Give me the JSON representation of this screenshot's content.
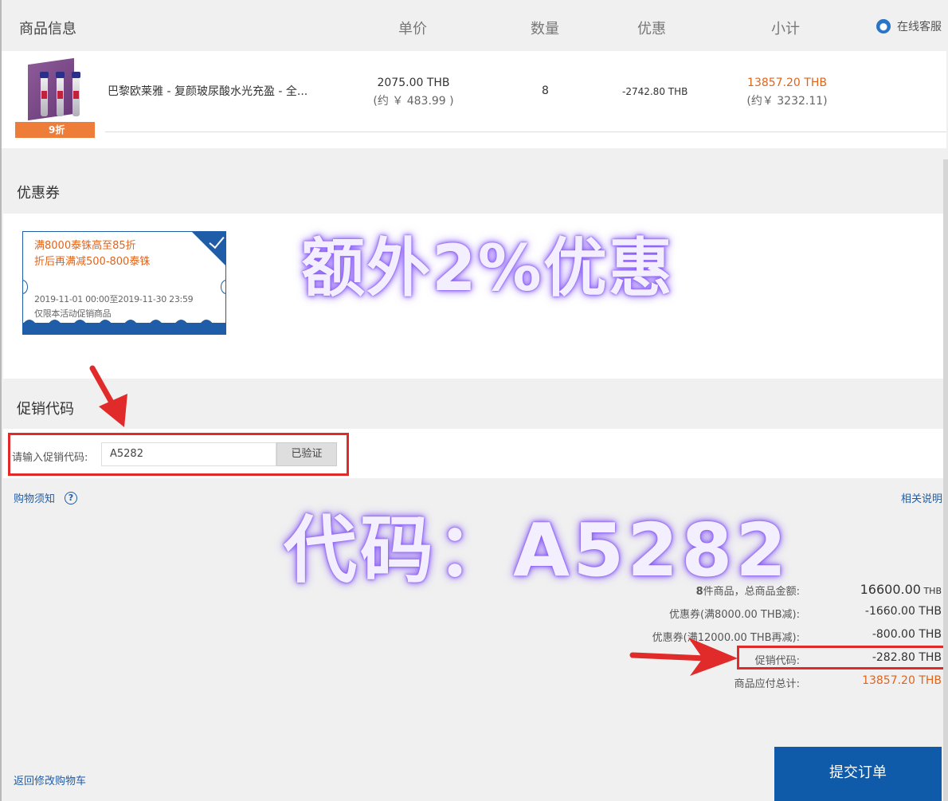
{
  "header": {
    "product_info": "商品信息",
    "unit_price": "单价",
    "quantity": "数量",
    "discount": "优惠",
    "subtotal": "小计",
    "customer_service": "在线客服"
  },
  "product": {
    "tag": "9折",
    "name": "巴黎欧莱雅 - 复颜玻尿酸水光充盈 - 全...",
    "price": "2075.00 THB",
    "price_approx": "(约 ￥ 483.99 )",
    "quantity": "8",
    "discount": "-2742.80 THB",
    "subtotal": "13857.20 THB",
    "subtotal_approx": "(约￥ 3232.11)"
  },
  "coupons": {
    "title": "优惠券",
    "items": [
      {
        "line1": "满8000泰铢高至85折",
        "line2": "折后再满减500-800泰铢",
        "date": "2019-11-01 00:00至2019-11-30 23:59",
        "note": "仅限本活动促销商品"
      }
    ]
  },
  "promo": {
    "title": "促销代码",
    "label": "请输入促销代码:",
    "value": "A5282",
    "button": "已验证"
  },
  "links": {
    "shopping_notice": "购物须知",
    "related_info": "相关说明",
    "back_to_cart": "返回修改购物车"
  },
  "watermarks": {
    "top": "额外2%优惠",
    "middle": "代码：A5282"
  },
  "totals": [
    {
      "label_count": "8",
      "label": "件商品，总商品金额:",
      "value": "16600.00",
      "unit": " THB"
    },
    {
      "label": "优惠券(满8000.00 THB减):",
      "value": "-1660.00 THB"
    },
    {
      "label": "优惠券(满12000.00 THB再减):",
      "value": "-800.00 THB"
    },
    {
      "label": "促销代码:",
      "value": "-282.80 THB"
    },
    {
      "label": "商品应付总计:",
      "value": "13857.20 THB"
    }
  ],
  "submit": "提交订单",
  "colors": {
    "accent_blue": "#0f5ba9",
    "price_orange": "#e1641d",
    "annotation_red": "#e12a2a",
    "watermark_glow": "#8a5cf6"
  }
}
